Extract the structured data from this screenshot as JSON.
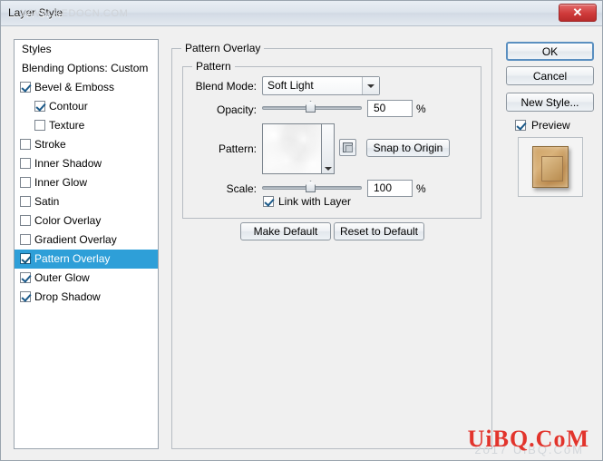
{
  "window": {
    "title": "Layer Style",
    "watermark_title": "WWW.REDOCN.COM",
    "close_label": "✕"
  },
  "styles_panel": {
    "items": [
      {
        "label": "Styles",
        "checkbox": false,
        "checked": false,
        "sub": false,
        "selected": false
      },
      {
        "label": "Blending Options: Custom",
        "checkbox": false,
        "checked": false,
        "sub": false,
        "selected": false
      },
      {
        "label": "Bevel & Emboss",
        "checkbox": true,
        "checked": true,
        "sub": false,
        "selected": false
      },
      {
        "label": "Contour",
        "checkbox": true,
        "checked": true,
        "sub": true,
        "selected": false
      },
      {
        "label": "Texture",
        "checkbox": true,
        "checked": false,
        "sub": true,
        "selected": false
      },
      {
        "label": "Stroke",
        "checkbox": true,
        "checked": false,
        "sub": false,
        "selected": false
      },
      {
        "label": "Inner Shadow",
        "checkbox": true,
        "checked": false,
        "sub": false,
        "selected": false
      },
      {
        "label": "Inner Glow",
        "checkbox": true,
        "checked": false,
        "sub": false,
        "selected": false
      },
      {
        "label": "Satin",
        "checkbox": true,
        "checked": false,
        "sub": false,
        "selected": false
      },
      {
        "label": "Color Overlay",
        "checkbox": true,
        "checked": false,
        "sub": false,
        "selected": false
      },
      {
        "label": "Gradient Overlay",
        "checkbox": true,
        "checked": false,
        "sub": false,
        "selected": false
      },
      {
        "label": "Pattern Overlay",
        "checkbox": true,
        "checked": true,
        "sub": false,
        "selected": true
      },
      {
        "label": "Outer Glow",
        "checkbox": true,
        "checked": true,
        "sub": false,
        "selected": false
      },
      {
        "label": "Drop Shadow",
        "checkbox": true,
        "checked": true,
        "sub": false,
        "selected": false
      }
    ]
  },
  "buttons": {
    "ok": "OK",
    "cancel": "Cancel",
    "new_style": "New Style...",
    "preview": "Preview",
    "make_default": "Make Default",
    "reset_to_default": "Reset to Default",
    "snap_to_origin": "Snap to Origin"
  },
  "main": {
    "group_title": "Pattern Overlay",
    "subgroup_title": "Pattern",
    "blend_mode_label": "Blend Mode:",
    "blend_mode_value": "Soft Light",
    "opacity_label": "Opacity:",
    "opacity_value": "50",
    "opacity_unit": "%",
    "pattern_label": "Pattern:",
    "scale_label": "Scale:",
    "scale_value": "100",
    "scale_unit": "%",
    "link_with_layer": "Link with Layer"
  },
  "watermarks": {
    "brand_red": "UiBQ.CoM",
    "brand_grey": "2o17 UiBQ.CoM"
  },
  "colors": {
    "selection": "#2e9fd8",
    "close_button": "#cf3a3a",
    "brand_red": "#e2342c"
  }
}
